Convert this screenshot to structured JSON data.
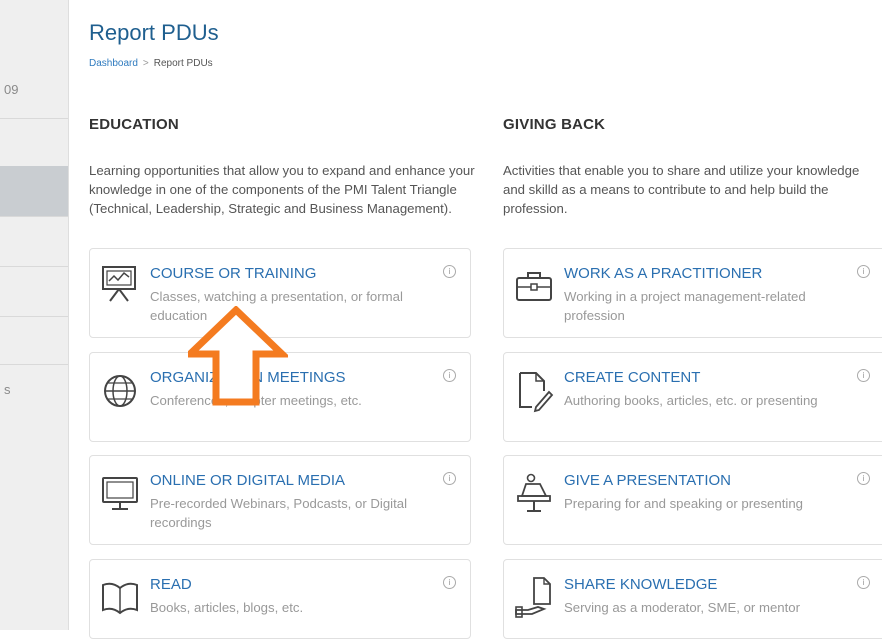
{
  "sidebar": {
    "items": [
      {
        "label": "09"
      },
      {
        "label": ""
      },
      {
        "label": ""
      },
      {
        "label": ""
      },
      {
        "label": ""
      },
      {
        "label": ""
      },
      {
        "label": "s"
      }
    ]
  },
  "header": {
    "title": "Report PDUs",
    "breadcrumb": {
      "home": "Dashboard",
      "separator": ">",
      "current": "Report PDUs"
    }
  },
  "education": {
    "heading": "EDUCATION",
    "description": "Learning opportunities that allow you to expand and enhance your knowledge in one of the components of the PMI Talent Triangle (Technical, Leadership, Strategic and Business Management).",
    "cards": [
      {
        "title": "COURSE OR TRAINING",
        "subtitle": "Classes, watching a presentation, or formal education",
        "icon": "presentation-board-icon"
      },
      {
        "title": "ORGANIZATION MEETINGS",
        "subtitle": "Conferences, chapter meetings, etc.",
        "icon": "globe-icon"
      },
      {
        "title": "ONLINE OR DIGITAL MEDIA",
        "subtitle": "Pre-recorded Webinars, Podcasts, or Digital recordings",
        "icon": "monitor-icon"
      },
      {
        "title": "READ",
        "subtitle": "Books, articles, blogs, etc.",
        "icon": "book-icon"
      }
    ]
  },
  "giving_back": {
    "heading": "GIVING BACK",
    "description": "Activities that enable you to share and utilize your knowledge and skilld as a means to contribute to and help build the profession.",
    "cards": [
      {
        "title": "WORK AS A PRACTITIONER",
        "subtitle": "Working in a project management-related profession",
        "icon": "briefcase-icon"
      },
      {
        "title": "CREATE CONTENT",
        "subtitle": "Authoring books, articles, etc. or presenting",
        "icon": "document-pen-icon"
      },
      {
        "title": "GIVE A PRESENTATION",
        "subtitle": "Preparing for and speaking or presenting",
        "icon": "podium-icon"
      },
      {
        "title": "SHARE KNOWLEDGE",
        "subtitle": "Serving as a moderator, SME, or mentor",
        "icon": "hand-document-icon"
      }
    ]
  },
  "info_glyph": "i",
  "colors": {
    "accent": "#2a6fb0",
    "title": "#1f5f8f",
    "annotation_arrow": "#f47b20"
  }
}
